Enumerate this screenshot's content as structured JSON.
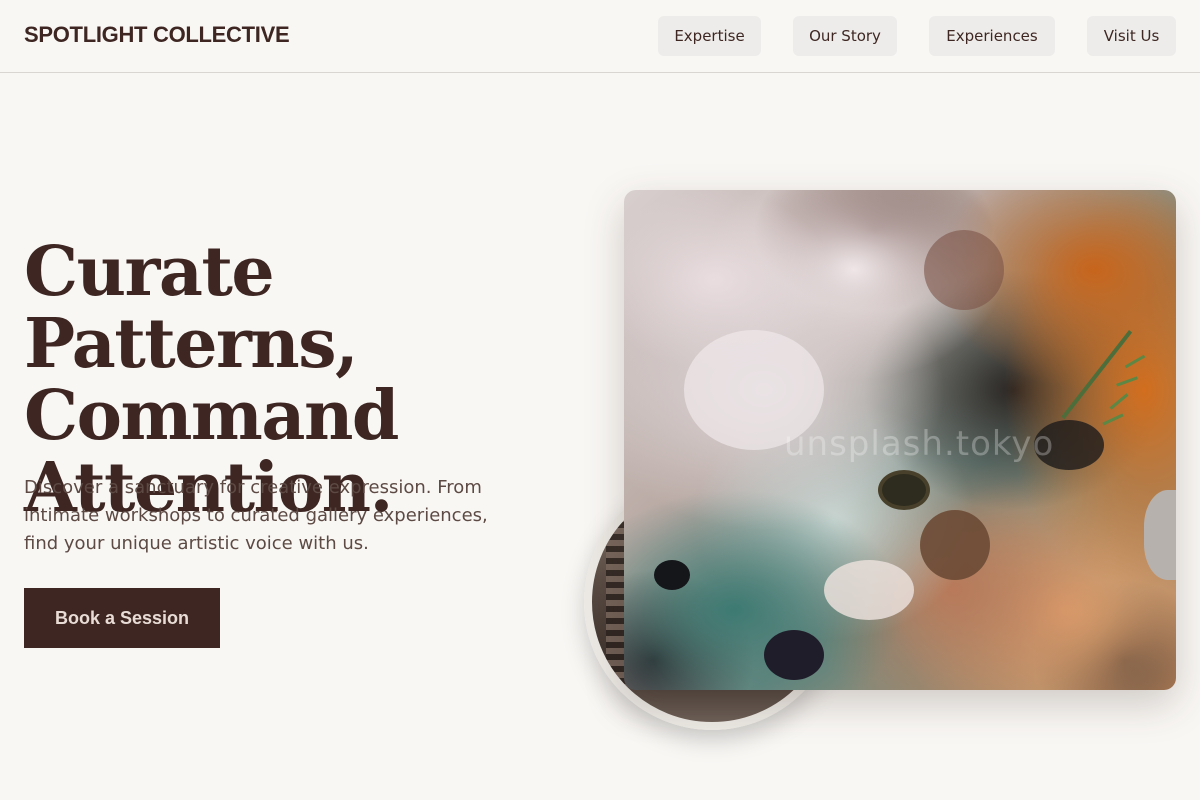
{
  "brand": {
    "logo": "SPOTLIGHT COLLECTIVE"
  },
  "nav": {
    "items": [
      {
        "label": "Expertise"
      },
      {
        "label": "Our Story"
      },
      {
        "label": "Experiences"
      },
      {
        "label": "Visit Us"
      }
    ]
  },
  "hero": {
    "headline_line1": "Curate Patterns,",
    "headline_line2": "Command",
    "headline_line3": "Attention.",
    "subtext": "Discover a sanctuary for creative expression. From intimate workshops to curated gallery experiences, find your unique artistic voice with us.",
    "cta_label": "Book a Session",
    "image_watermark": "unsplash.tokyo",
    "main_image_alt": "Textured oil paint palette with white, orange, teal and black swirls",
    "circle_image_alt": "Artist studio interior"
  },
  "colors": {
    "background": "#f9f7f4",
    "primary_text": "#3e2723",
    "cta_background": "#3e2723",
    "cta_text": "#e9dcd6",
    "nav_button_bg": "#eeecea"
  },
  "icons": {}
}
